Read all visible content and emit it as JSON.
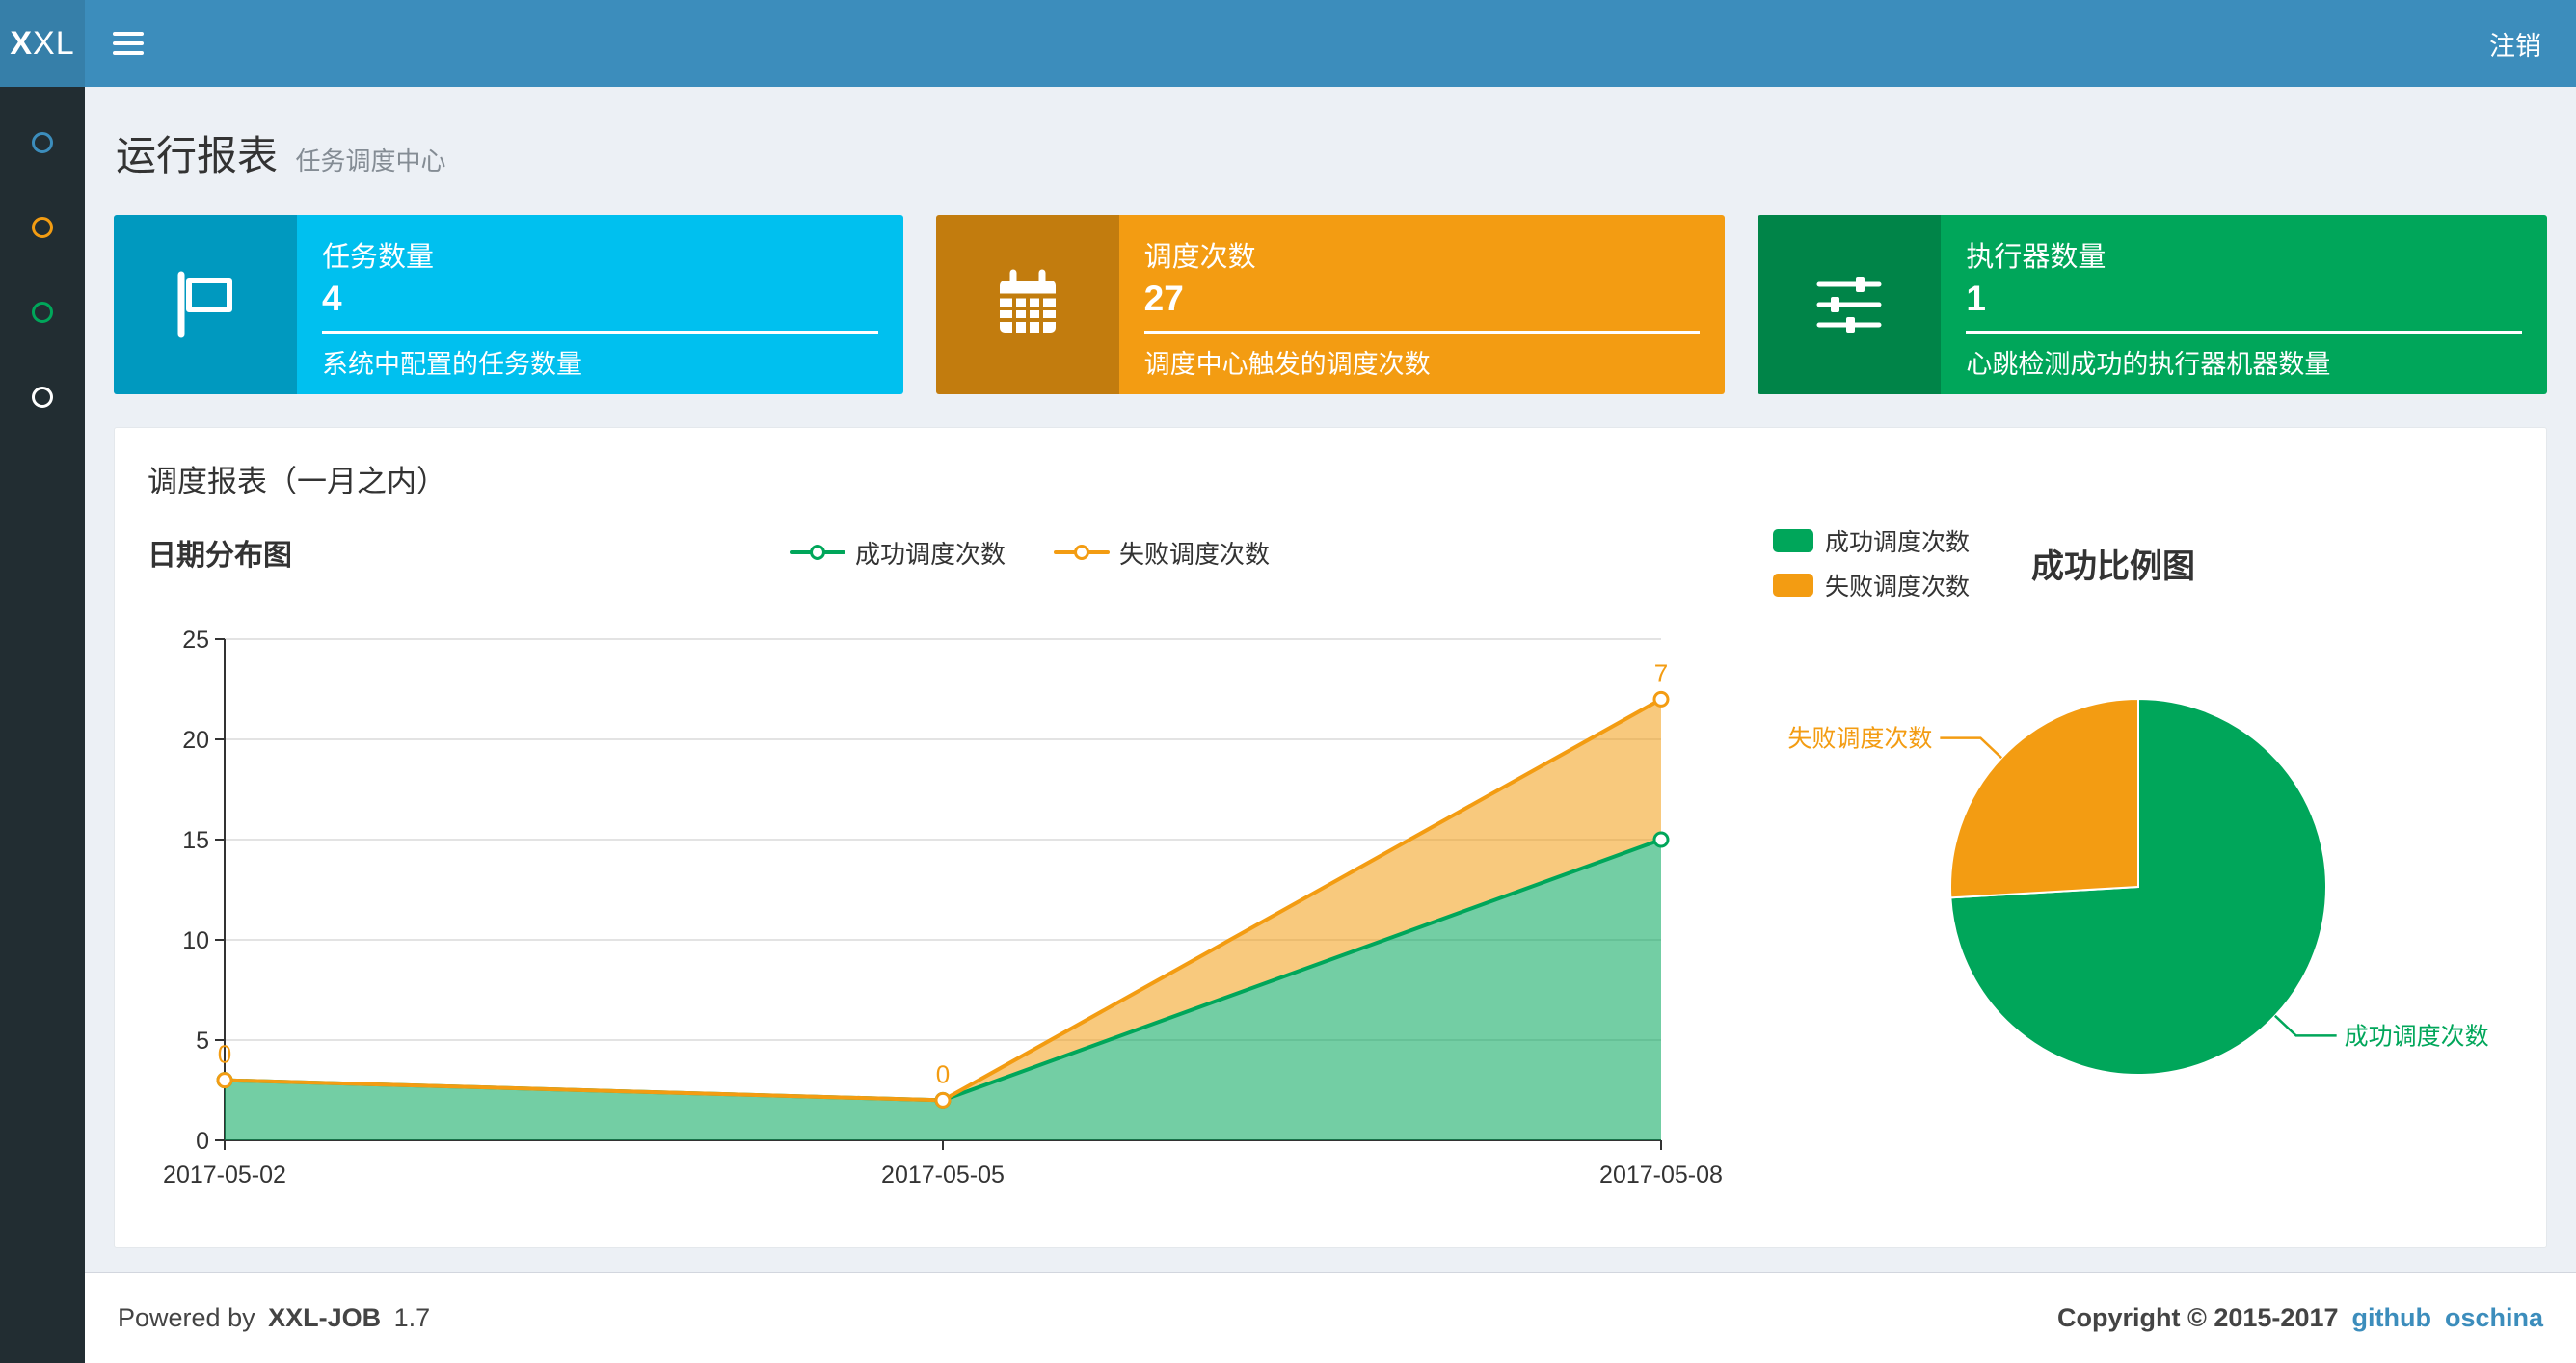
{
  "navbar": {
    "logo_bold": "X",
    "logo_rest": "XL",
    "logout_label": "注销"
  },
  "sidebar": {
    "items": [
      {
        "icon": "circle-icon",
        "color": "#3c8dbc"
      },
      {
        "icon": "circle-icon",
        "color": "#f39c12"
      },
      {
        "icon": "circle-icon",
        "color": "#00a65a"
      },
      {
        "icon": "circle-icon",
        "color": "#ffffff"
      }
    ]
  },
  "page_header": {
    "title": "运行报表",
    "subtitle": "任务调度中心"
  },
  "info_boxes": [
    {
      "label": "任务数量",
      "value": "4",
      "description": "系统中配置的任务数量",
      "color": "#00c0ef",
      "icon": "flag-icon"
    },
    {
      "label": "调度次数",
      "value": "27",
      "description": "调度中心触发的调度次数",
      "color": "#f39c12",
      "icon": "calendar-icon"
    },
    {
      "label": "执行器数量",
      "value": "1",
      "description": "心跳检测成功的执行器机器数量",
      "color": "#00a65a",
      "icon": "sliders-icon"
    }
  ],
  "panel": {
    "title": "调度报表（一月之内）"
  },
  "chart_data": [
    {
      "type": "area",
      "title": "日期分布图",
      "x": [
        "2017-05-02",
        "2017-05-05",
        "2017-05-08"
      ],
      "series": [
        {
          "name": "成功调度次数",
          "values": [
            3,
            2,
            15
          ],
          "color": "#00a65a"
        },
        {
          "name": "失败调度次数",
          "values": [
            0,
            0,
            7
          ],
          "color": "#f39c12",
          "show_labels": true
        }
      ],
      "stacked": true,
      "ylim": [
        0,
        25
      ],
      "yticks": [
        0,
        5,
        10,
        15,
        20,
        25
      ],
      "grid": true,
      "legend_position": "top"
    },
    {
      "type": "pie",
      "title": "成功比例图",
      "slices": [
        {
          "name": "成功调度次数",
          "value": 20,
          "color": "#00a65a"
        },
        {
          "name": "失败调度次数",
          "value": 7,
          "color": "#f39c12"
        }
      ],
      "legend_position": "top-left"
    }
  ],
  "footer": {
    "powered_prefix": "Powered by",
    "product": "XXL-JOB",
    "version": "1.7",
    "copyright": "Copyright © 2015-2017",
    "links": [
      {
        "label": "github"
      },
      {
        "label": "oschina"
      }
    ]
  }
}
